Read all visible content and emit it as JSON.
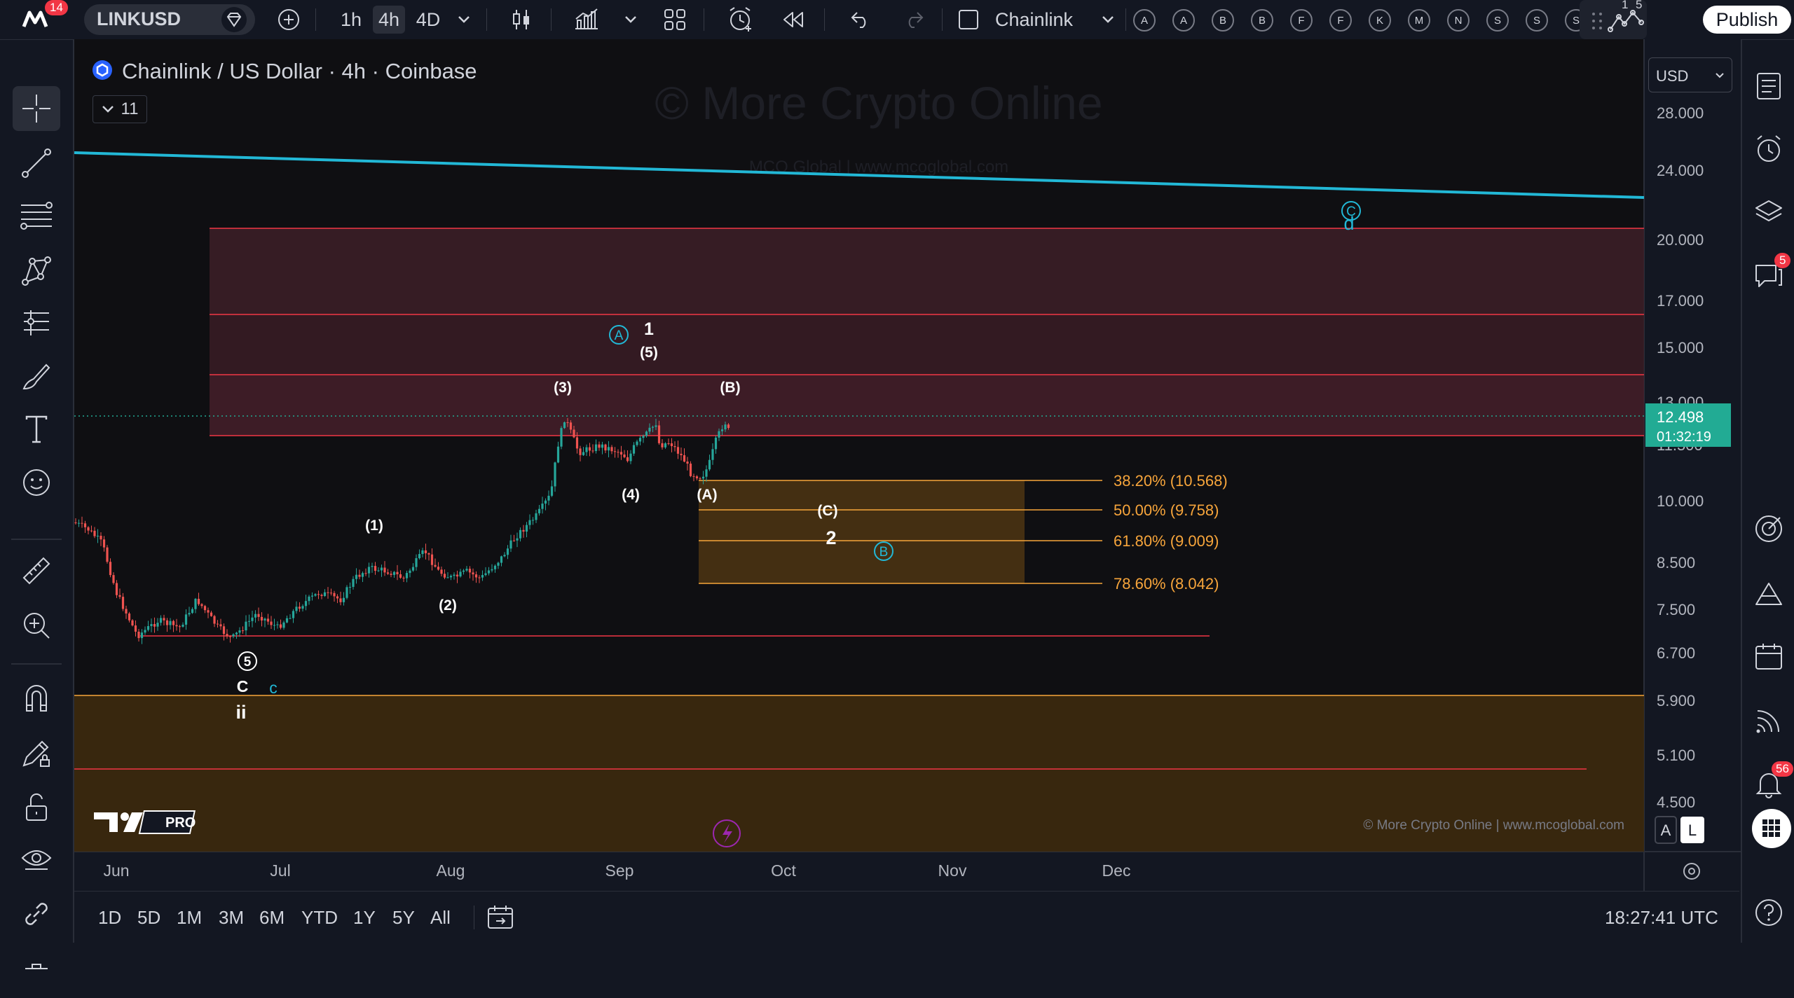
{
  "app": {
    "symbol": "LINKUSD",
    "notification_count": "14",
    "timeframes": [
      "1h",
      "4h",
      "4D"
    ],
    "active_timeframe": "4h",
    "layout_name": "Chainlink",
    "alphabet_buttons": [
      "A",
      "A",
      "B",
      "B",
      "F",
      "F",
      "K",
      "M",
      "N",
      "S",
      "S",
      "S"
    ],
    "publish_label": "Publish",
    "top_right_digits": [
      "1",
      "5"
    ]
  },
  "chart": {
    "title": "Chainlink / US Dollar · 4h · Coinbase",
    "indicator_count": "11",
    "watermark": "© More Crypto Online",
    "watermark_sub": "MCO Global   |   www.mcoglobal.com",
    "footer_credit": "© More Crypto Online   |   www.mcoglobal.com",
    "currency": "USD",
    "price_label": "12.498",
    "countdown": "01:32:19",
    "hidden_tick": "11.500",
    "price_ticks": [
      "28.000",
      "24.000",
      "20.000",
      "17.000",
      "15.000",
      "13.000",
      "10.000",
      "8.500",
      "7.500",
      "6.700",
      "5.900",
      "5.100",
      "4.500"
    ],
    "time_ticks": [
      "Jun",
      "Jul",
      "Aug",
      "Sep",
      "Oct",
      "Nov",
      "Dec"
    ],
    "fib_levels": [
      "38.20% (10.568)",
      "50.00% (9.758)",
      "61.80% (9.009)",
      "78.60% (8.042)"
    ],
    "wave_labels": {
      "w1": "(1)",
      "w2": "(2)",
      "w3": "(3)",
      "w4": "(4)",
      "w5": "(5)",
      "one": "1",
      "two": "2",
      "A_circle": "A",
      "B_circle": "B",
      "C_circle": "C",
      "wA": "(A)",
      "wB": "(B)",
      "wC": "(C)",
      "d": "d",
      "five_circle": "5",
      "C_letter": "C",
      "c_letter": "c",
      "ii": "ii"
    },
    "auto_label": "A",
    "log_label": "L",
    "logo_text": "PRO",
    "colors": {
      "up": "#26a69a",
      "down": "#ef5350",
      "trendline": "#22b8d6",
      "resistance_zone": "#3d1e28",
      "fib_zone": "#4a3313",
      "fib_text": "#f7a53b",
      "support_zone": "#3d2a0e",
      "price_label_bg": "#22ab94"
    }
  },
  "bottom": {
    "ranges": [
      "1D",
      "5D",
      "1M",
      "3M",
      "6M",
      "YTD",
      "1Y",
      "5Y",
      "All"
    ],
    "clock": "18:27:41 UTC"
  },
  "right_badges": {
    "chat": "5",
    "notifications": "56"
  }
}
